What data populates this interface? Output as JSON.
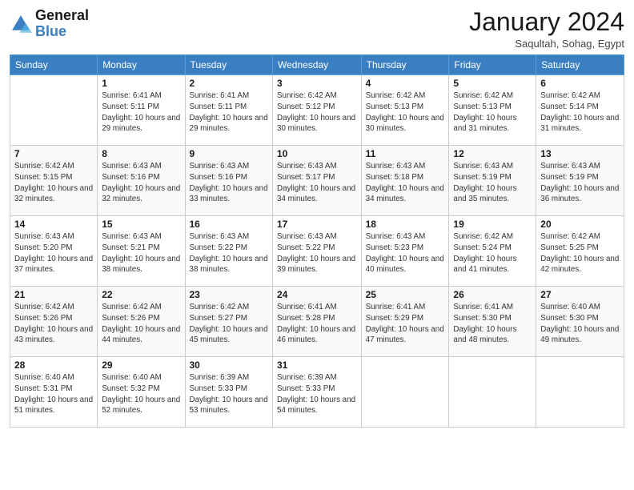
{
  "logo": {
    "text_general": "General",
    "text_blue": "Blue"
  },
  "header": {
    "month_year": "January 2024",
    "location": "Saqultah, Sohag, Egypt"
  },
  "days_of_week": [
    "Sunday",
    "Monday",
    "Tuesday",
    "Wednesday",
    "Thursday",
    "Friday",
    "Saturday"
  ],
  "weeks": [
    [
      {
        "day": "",
        "info": ""
      },
      {
        "day": "1",
        "info": "Sunrise: 6:41 AM\nSunset: 5:11 PM\nDaylight: 10 hours\nand 29 minutes."
      },
      {
        "day": "2",
        "info": "Sunrise: 6:41 AM\nSunset: 5:11 PM\nDaylight: 10 hours\nand 29 minutes."
      },
      {
        "day": "3",
        "info": "Sunrise: 6:42 AM\nSunset: 5:12 PM\nDaylight: 10 hours\nand 30 minutes."
      },
      {
        "day": "4",
        "info": "Sunrise: 6:42 AM\nSunset: 5:13 PM\nDaylight: 10 hours\nand 30 minutes."
      },
      {
        "day": "5",
        "info": "Sunrise: 6:42 AM\nSunset: 5:13 PM\nDaylight: 10 hours\nand 31 minutes."
      },
      {
        "day": "6",
        "info": "Sunrise: 6:42 AM\nSunset: 5:14 PM\nDaylight: 10 hours\nand 31 minutes."
      }
    ],
    [
      {
        "day": "7",
        "info": "Sunrise: 6:42 AM\nSunset: 5:15 PM\nDaylight: 10 hours\nand 32 minutes."
      },
      {
        "day": "8",
        "info": "Sunrise: 6:43 AM\nSunset: 5:16 PM\nDaylight: 10 hours\nand 32 minutes."
      },
      {
        "day": "9",
        "info": "Sunrise: 6:43 AM\nSunset: 5:16 PM\nDaylight: 10 hours\nand 33 minutes."
      },
      {
        "day": "10",
        "info": "Sunrise: 6:43 AM\nSunset: 5:17 PM\nDaylight: 10 hours\nand 34 minutes."
      },
      {
        "day": "11",
        "info": "Sunrise: 6:43 AM\nSunset: 5:18 PM\nDaylight: 10 hours\nand 34 minutes."
      },
      {
        "day": "12",
        "info": "Sunrise: 6:43 AM\nSunset: 5:19 PM\nDaylight: 10 hours\nand 35 minutes."
      },
      {
        "day": "13",
        "info": "Sunrise: 6:43 AM\nSunset: 5:19 PM\nDaylight: 10 hours\nand 36 minutes."
      }
    ],
    [
      {
        "day": "14",
        "info": "Sunrise: 6:43 AM\nSunset: 5:20 PM\nDaylight: 10 hours\nand 37 minutes."
      },
      {
        "day": "15",
        "info": "Sunrise: 6:43 AM\nSunset: 5:21 PM\nDaylight: 10 hours\nand 38 minutes."
      },
      {
        "day": "16",
        "info": "Sunrise: 6:43 AM\nSunset: 5:22 PM\nDaylight: 10 hours\nand 38 minutes."
      },
      {
        "day": "17",
        "info": "Sunrise: 6:43 AM\nSunset: 5:22 PM\nDaylight: 10 hours\nand 39 minutes."
      },
      {
        "day": "18",
        "info": "Sunrise: 6:43 AM\nSunset: 5:23 PM\nDaylight: 10 hours\nand 40 minutes."
      },
      {
        "day": "19",
        "info": "Sunrise: 6:42 AM\nSunset: 5:24 PM\nDaylight: 10 hours\nand 41 minutes."
      },
      {
        "day": "20",
        "info": "Sunrise: 6:42 AM\nSunset: 5:25 PM\nDaylight: 10 hours\nand 42 minutes."
      }
    ],
    [
      {
        "day": "21",
        "info": "Sunrise: 6:42 AM\nSunset: 5:26 PM\nDaylight: 10 hours\nand 43 minutes."
      },
      {
        "day": "22",
        "info": "Sunrise: 6:42 AM\nSunset: 5:26 PM\nDaylight: 10 hours\nand 44 minutes."
      },
      {
        "day": "23",
        "info": "Sunrise: 6:42 AM\nSunset: 5:27 PM\nDaylight: 10 hours\nand 45 minutes."
      },
      {
        "day": "24",
        "info": "Sunrise: 6:41 AM\nSunset: 5:28 PM\nDaylight: 10 hours\nand 46 minutes."
      },
      {
        "day": "25",
        "info": "Sunrise: 6:41 AM\nSunset: 5:29 PM\nDaylight: 10 hours\nand 47 minutes."
      },
      {
        "day": "26",
        "info": "Sunrise: 6:41 AM\nSunset: 5:30 PM\nDaylight: 10 hours\nand 48 minutes."
      },
      {
        "day": "27",
        "info": "Sunrise: 6:40 AM\nSunset: 5:30 PM\nDaylight: 10 hours\nand 49 minutes."
      }
    ],
    [
      {
        "day": "28",
        "info": "Sunrise: 6:40 AM\nSunset: 5:31 PM\nDaylight: 10 hours\nand 51 minutes."
      },
      {
        "day": "29",
        "info": "Sunrise: 6:40 AM\nSunset: 5:32 PM\nDaylight: 10 hours\nand 52 minutes."
      },
      {
        "day": "30",
        "info": "Sunrise: 6:39 AM\nSunset: 5:33 PM\nDaylight: 10 hours\nand 53 minutes."
      },
      {
        "day": "31",
        "info": "Sunrise: 6:39 AM\nSunset: 5:33 PM\nDaylight: 10 hours\nand 54 minutes."
      },
      {
        "day": "",
        "info": ""
      },
      {
        "day": "",
        "info": ""
      },
      {
        "day": "",
        "info": ""
      }
    ]
  ]
}
